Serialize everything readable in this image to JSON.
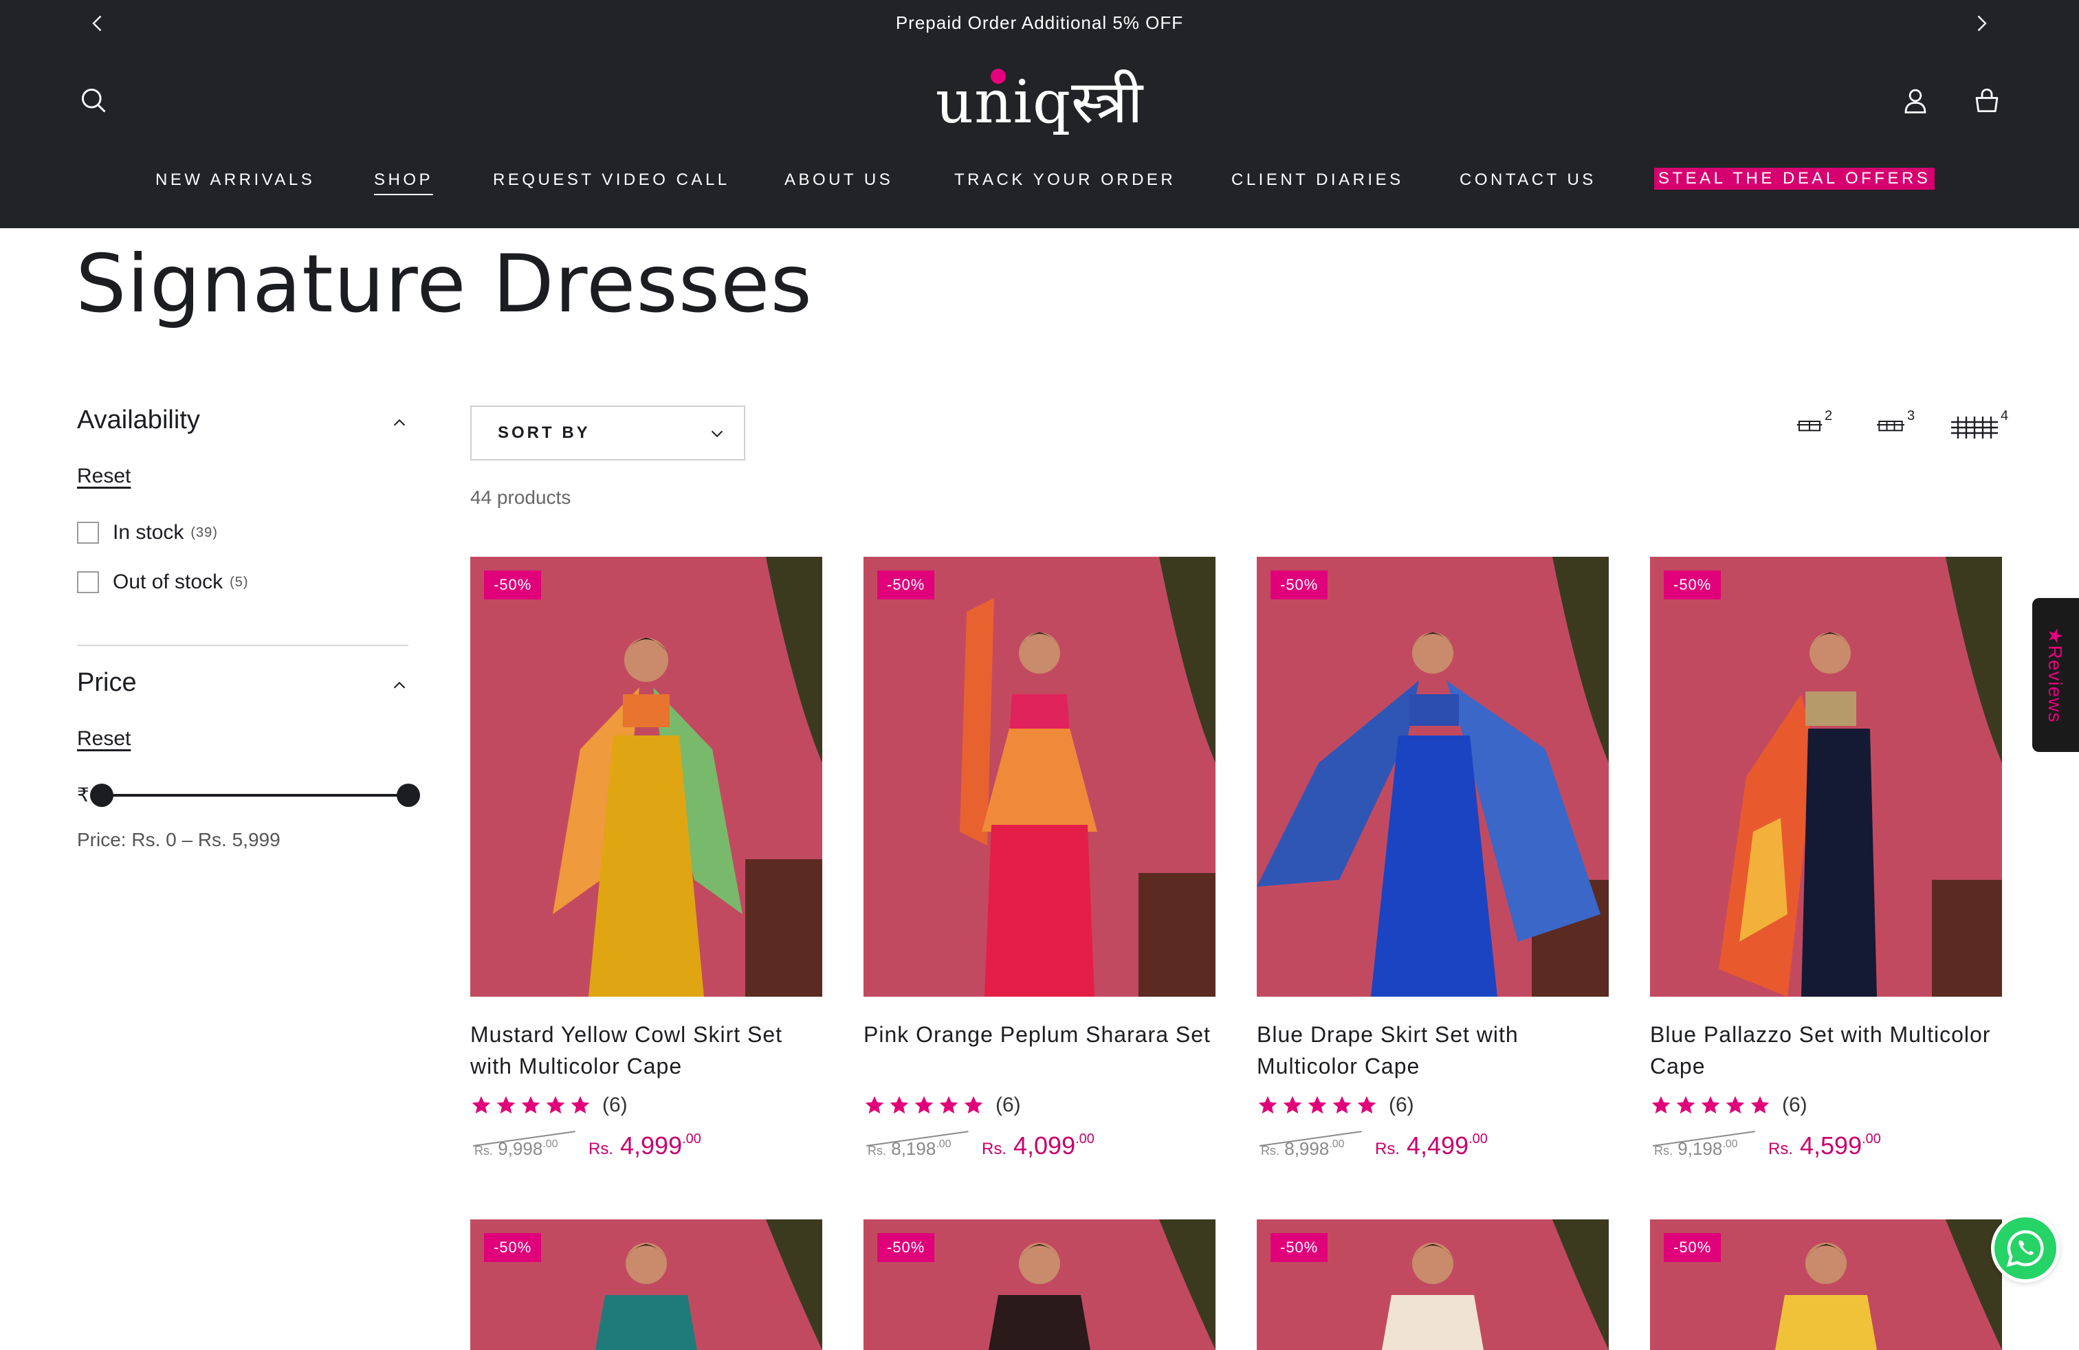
{
  "announcement": {
    "text": "Prepaid Order Additional 5% OFF"
  },
  "brand": {
    "logo_text": "uniqस्त्री"
  },
  "nav": [
    {
      "label": "NEW ARRIVALS"
    },
    {
      "label": "SHOP"
    },
    {
      "label": "REQUEST VIDEO CALL"
    },
    {
      "label": "ABOUT US"
    },
    {
      "label": "TRACK YOUR ORDER"
    },
    {
      "label": "CLIENT DIARIES"
    },
    {
      "label": "CONTACT US"
    },
    {
      "label": "STEAL THE DEAL OFFERS"
    }
  ],
  "page": {
    "title": "Signature Dresses"
  },
  "filters": {
    "availability": {
      "heading": "Availability",
      "reset": "Reset",
      "options": [
        {
          "label": "In stock",
          "count": "(39)"
        },
        {
          "label": "Out of stock",
          "count": "(5)"
        }
      ]
    },
    "price": {
      "heading": "Price",
      "reset": "Reset",
      "currency_symbol": "₹",
      "range_text": "Price: Rs. 0 – Rs. 5,999",
      "min_fraction": 0,
      "max_fraction": 1
    }
  },
  "toolbar": {
    "sort_label": "SORT BY",
    "product_count": "44 products",
    "grid_options": [
      "2",
      "3",
      "4"
    ]
  },
  "products": [
    {
      "badge": "-50%",
      "title": "Mustard Yellow Cowl Skirt Set with Multicolor Cape",
      "rating": 5,
      "reviews": "(6)",
      "compare_cur": "Rs.",
      "compare_int": "9,998",
      "compare_dec": ".00",
      "sale_cur": "Rs.",
      "sale_int": "4,999",
      "sale_dec": ".00"
    },
    {
      "badge": "-50%",
      "title": "Pink Orange Peplum Sharara Set",
      "rating": 5,
      "reviews": "(6)",
      "compare_cur": "Rs.",
      "compare_int": "8,198",
      "compare_dec": ".00",
      "sale_cur": "Rs.",
      "sale_int": "4,099",
      "sale_dec": ".00"
    },
    {
      "badge": "-50%",
      "title": "Blue Drape Skirt Set with Multicolor Cape",
      "rating": 5,
      "reviews": "(6)",
      "compare_cur": "Rs.",
      "compare_int": "8,998",
      "compare_dec": ".00",
      "sale_cur": "Rs.",
      "sale_int": "4,499",
      "sale_dec": ".00"
    },
    {
      "badge": "-50%",
      "title": "Blue Pallazzo Set with Multicolor Cape",
      "rating": 5,
      "reviews": "(6)",
      "compare_cur": "Rs.",
      "compare_int": "9,198",
      "compare_dec": ".00",
      "sale_cur": "Rs.",
      "sale_int": "4,599",
      "sale_dec": ".00"
    },
    {
      "badge": "-50%"
    },
    {
      "badge": "-50%"
    },
    {
      "badge": "-50%"
    },
    {
      "badge": "-50%"
    }
  ],
  "widgets": {
    "reviews_tab": "★Reviews"
  },
  "colors": {
    "header_bg": "#222327",
    "accent": "#e0007a",
    "price": "#c7006b",
    "backdrop": "#c24a60"
  }
}
